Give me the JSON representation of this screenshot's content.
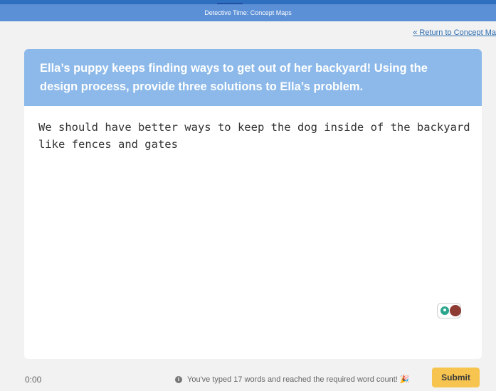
{
  "header": {
    "title": "Detective Time: Concept Maps"
  },
  "nav": {
    "return_link": "« Return to Concept Ma"
  },
  "question": {
    "prompt": "Ella’s puppy keeps finding ways to get out of her backyard! Using the design process, provide three solutions to Ella’s problem."
  },
  "answer": {
    "text": "We should have better ways to keep the dog inside of the backyard like fences and gates"
  },
  "footer": {
    "timer": "0:00",
    "status": "You've typed 17 words and reached the required word count!",
    "submit_label": "Submit"
  },
  "icons": {
    "info": "info-icon",
    "celebrate": "party-popper-icon",
    "hint": "lightbulb-icon",
    "helper": "avatar"
  },
  "colors": {
    "header_blue": "#5b8fd6",
    "prompt_blue": "#8cb9ea",
    "submit_yellow": "#f6c44f",
    "link_blue": "#2b6cb0"
  }
}
